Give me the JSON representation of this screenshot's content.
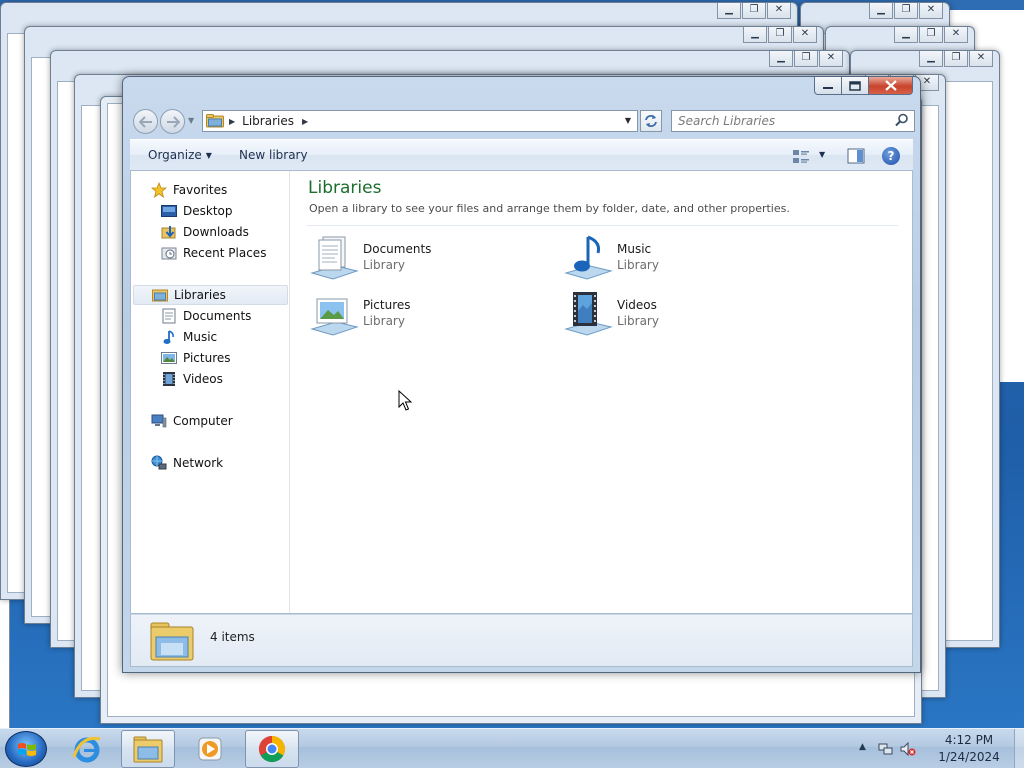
{
  "window": {
    "address": {
      "crumb": "Libraries"
    },
    "search": {
      "placeholder": "Search Libraries"
    },
    "command_bar": {
      "organize": "Organize",
      "new_library": "New library"
    },
    "nav_pane": {
      "favorites": "Favorites",
      "favorites_items": [
        "Desktop",
        "Downloads",
        "Recent Places"
      ],
      "libraries": "Libraries",
      "libraries_items": [
        "Documents",
        "Music",
        "Pictures",
        "Videos"
      ],
      "computer": "Computer",
      "network": "Network"
    },
    "content": {
      "title": "Libraries",
      "subtitle": "Open a library to see your files and arrange them by folder, date, and other properties.",
      "libraries": [
        {
          "name": "Documents",
          "kind": "Library",
          "icon": "documents-library-icon"
        },
        {
          "name": "Music",
          "kind": "Library",
          "icon": "music-library-icon"
        },
        {
          "name": "Pictures",
          "kind": "Library",
          "icon": "pictures-library-icon"
        },
        {
          "name": "Videos",
          "kind": "Library",
          "icon": "videos-library-icon"
        }
      ]
    },
    "details": {
      "item_count": "4 items"
    }
  },
  "taskbar": {
    "pinned": [
      "internet-explorer-icon",
      "windows-explorer-icon",
      "media-player-icon",
      "chrome-icon"
    ],
    "tray": {
      "time": "4:12 PM",
      "date": "1/24/2024"
    }
  }
}
